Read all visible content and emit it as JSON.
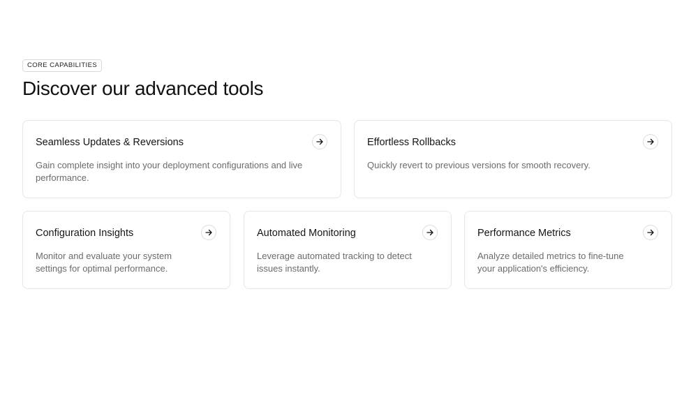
{
  "section": {
    "eyebrow": "CORE CAPABILITIES",
    "title": "Discover our advanced tools"
  },
  "cards": [
    {
      "title": "Seamless Updates & Reversions",
      "description": "Gain complete insight into your deployment configurations and live performance.",
      "icon": "arrow-right-icon"
    },
    {
      "title": "Effortless Rollbacks",
      "description": "Quickly revert to previous versions for smooth recovery.",
      "icon": "arrow-right-icon"
    },
    {
      "title": "Configuration Insights",
      "description": "Monitor and evaluate your system settings for optimal performance.",
      "icon": "arrow-right-icon"
    },
    {
      "title": "Automated Monitoring",
      "description": "Leverage automated tracking to detect issues instantly.",
      "icon": "arrow-right-icon"
    },
    {
      "title": "Performance Metrics",
      "description": "Analyze detailed metrics to fine-tune your application's efficiency.",
      "icon": "arrow-right-icon"
    }
  ]
}
